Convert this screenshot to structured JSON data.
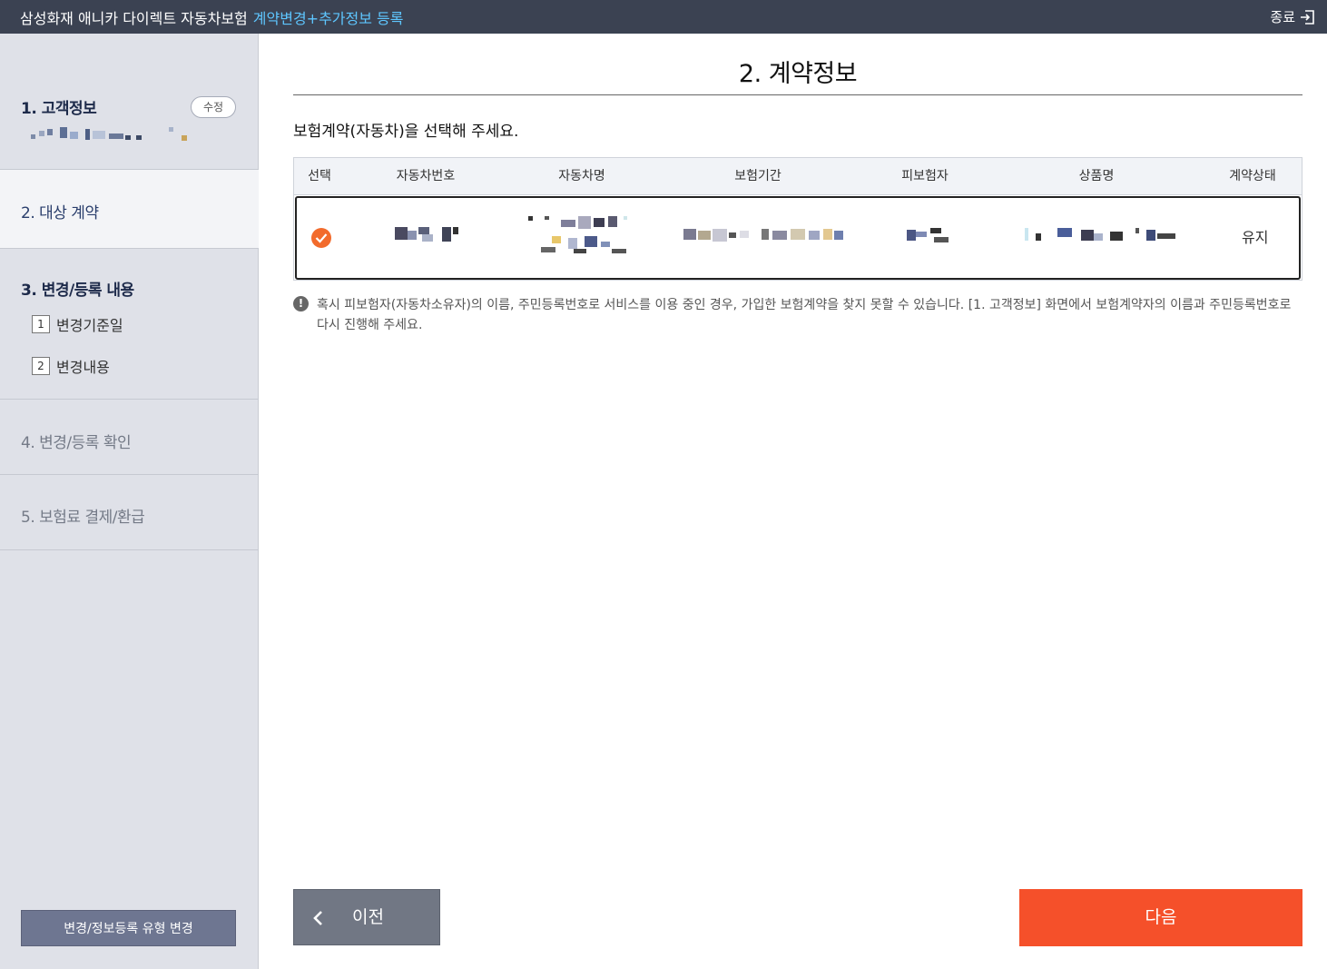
{
  "header": {
    "app_title": "삼성화재 애니카 다이렉트 자동차보험",
    "flow_title": "계약변경+추가정보 등록",
    "exit_label": "종료"
  },
  "sidebar": {
    "steps": [
      {
        "label": "1. 고객정보",
        "edit_label": "수정"
      },
      {
        "label": "2. 대상 계약"
      },
      {
        "label": "3. 변경/등록 내용",
        "subs": [
          {
            "num": "1",
            "label": "변경기준일"
          },
          {
            "num": "2",
            "label": "변경내용"
          }
        ]
      },
      {
        "label": "4. 변경/등록 확인"
      },
      {
        "label": "5. 보험료 결제/환급"
      }
    ],
    "change_type_button": "변경/정보등록 유형 변경"
  },
  "main": {
    "title": "2. 계약정보",
    "instruction": "보험계약(자동차)을 선택해 주세요.",
    "table": {
      "headers": [
        "선택",
        "자동차번호",
        "자동차명",
        "보험기간",
        "피보험자",
        "상품명",
        "계약상태"
      ],
      "rows": [
        {
          "selected": true,
          "status": "유지"
        }
      ]
    },
    "notice": "혹시 피보험자(자동차소유자)의 이름, 주민등록번호로 서비스를 이용 중인 경우, 가입한 보험계약을 찾지 못할 수 있습니다. [1. 고객정보] 화면에서 보험계약자의 이름과 주민등록번호로 다시 진행해 주세요.",
    "prev_button": "이전",
    "next_button": "다음"
  },
  "colors": {
    "topbar_bg": "#3b4252",
    "accent_blue": "#5ec6ff",
    "next_orange": "#f5502a",
    "check_orange": "#f26b2c",
    "sidebar_bg": "#dfe1e8"
  }
}
